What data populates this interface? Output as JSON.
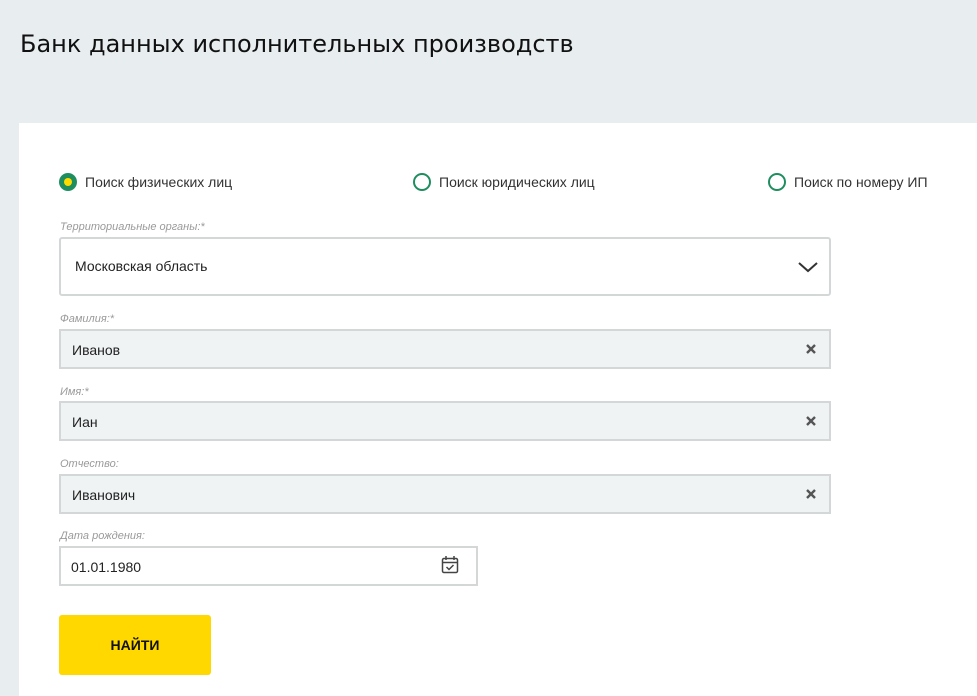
{
  "header": {
    "title": "Банк данных исполнительных производств"
  },
  "search_type": {
    "options": [
      {
        "label": "Поиск физических лиц",
        "selected": true
      },
      {
        "label": "Поиск юридических лиц",
        "selected": false
      },
      {
        "label": "Поиск по номеру ИП",
        "selected": false
      }
    ]
  },
  "form": {
    "region": {
      "label": "Территориальные органы:*",
      "value": "Московская область"
    },
    "last_name": {
      "label": "Фамилия:*",
      "value": "Иванов"
    },
    "first_name": {
      "label": "Имя:*",
      "value": "Иан"
    },
    "patronymic": {
      "label": "Отчество:",
      "value": "Иванович"
    },
    "birth_date": {
      "label": "Дата рождения:",
      "value": "01.01.1980"
    },
    "submit_label": "НАЙТИ"
  },
  "colors": {
    "accent_green": "#1f8e5f",
    "accent_yellow": "#ffd800",
    "background": "#e8eef0"
  },
  "icons": {
    "chevron": "chevron-down-icon",
    "clear": "clear-icon",
    "calendar": "calendar-icon"
  }
}
